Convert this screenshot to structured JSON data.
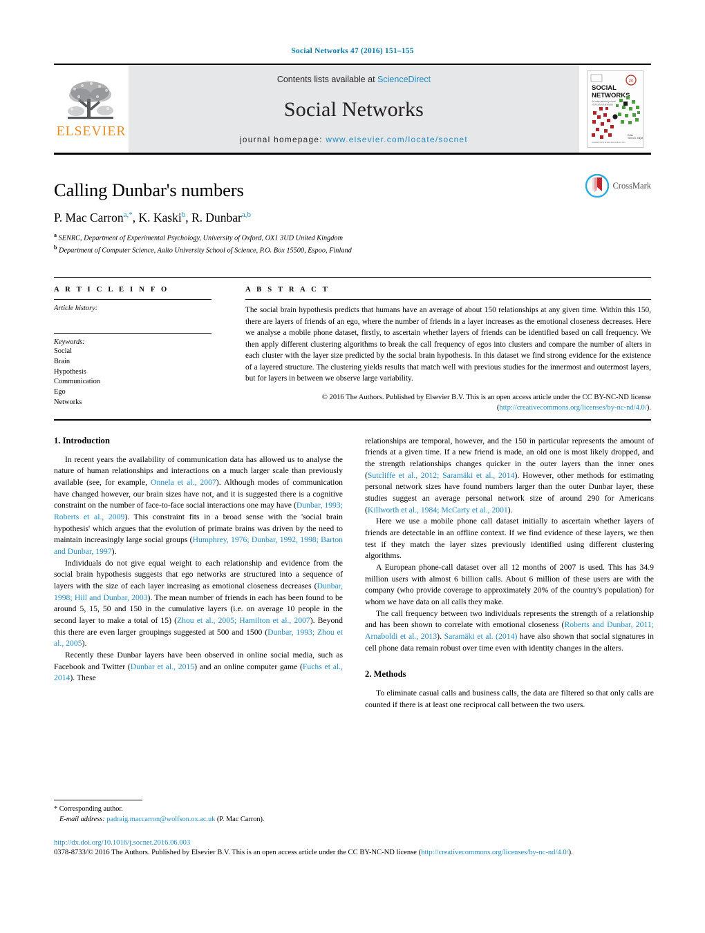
{
  "running_head": "Social Networks 47 (2016) 151–155",
  "masthead": {
    "publisher_name": "ELSEVIER",
    "contents_prefix": "Contents lists available at ",
    "contents_link": "ScienceDirect",
    "journal_title": "Social Networks",
    "homepage_prefix": "journal homepage:",
    "homepage_url": "www.elsevier.com/locate/socnet",
    "cover": {
      "line1": "SOCIAL",
      "line2": "NETWORKS",
      "tagline": "An international journal of structural analysis",
      "badge": "20",
      "editor_label": "Editor",
      "editor_name": "Tom A.B. Snijders"
    }
  },
  "article": {
    "title": "Calling Dunbar's numbers",
    "crossmark_label": "CrossMark",
    "authors_html": "P. Mac Carron<sup>a,*</sup>, K. Kaski<sup>b</sup>, R. Dunbar<sup>a,b</sup>",
    "affiliations": [
      {
        "marker": "a",
        "text": "SENRC, Department of Experimental Psychology, University of Oxford, OX1 3UD United Kingdom"
      },
      {
        "marker": "b",
        "text": "Department of Computer Science, Aalto University School of Science, P.O. Box 15500, Espoo, Finland"
      }
    ]
  },
  "article_info": {
    "heading": "A R T I C L E   I N F O",
    "history_label": "Article history:",
    "keywords_label": "Keywords:",
    "keywords": [
      "Social",
      "Brain",
      "Hypothesis",
      "Communication",
      "Ego",
      "Networks"
    ]
  },
  "abstract": {
    "heading": "A B S T R A C T",
    "text": "The social brain hypothesis predicts that humans have an average of about 150 relationships at any given time. Within this 150, there are layers of friends of an ego, where the number of friends in a layer increases as the emotional closeness decreases. Here we analyse a mobile phone dataset, firstly, to ascertain whether layers of friends can be identified based on call frequency. We then apply different clustering algorithms to break the call frequency of egos into clusters and compare the number of alters in each cluster with the layer size predicted by the social brain hypothesis. In this dataset we find strong evidence for the existence of a layered structure. The clustering yields results that match well with previous studies for the innermost and outermost layers, but for layers in between we observe large variability.",
    "copyright_pre": "© 2016 The Authors. Published by Elsevier B.V. This is an open access article under the CC BY-NC-ND license (",
    "copyright_link": "http://creativecommons.org/licenses/by-nc-nd/4.0/",
    "copyright_post": ")."
  },
  "sections": {
    "introduction_heading": "1.  Introduction",
    "methods_heading": "2.  Methods"
  },
  "left_column": {
    "p1_a": "In recent years the availability of communication data has allowed us to analyse the nature of human relationships and interactions on a much larger scale than previously available (see, for example, ",
    "p1_cite1": "Onnela et al., 2007",
    "p1_b": "). Although modes of communication have changed however, our brain sizes have not, and it is suggested there is a cognitive constraint on the number of face-to-face social interactions one may have (",
    "p1_cite2": "Dunbar, 1993; Roberts et al., 2009",
    "p1_c": "). This constraint fits in a broad sense with the 'social brain hypothesis' which argues that the evolution of primate brains was driven by the need to maintain increasingly large social groups (",
    "p1_cite3": "Humphrey, 1976; Dunbar, 1992, 1998; Barton and Dunbar, 1997",
    "p1_d": ").",
    "p2_a": "Individuals do not give equal weight to each relationship and evidence from the social brain hypothesis suggests that ego networks are structured into a sequence of layers with the size of each layer increasing as emotional closeness decreases (",
    "p2_cite1": "Dunbar, 1998; Hill and Dunbar, 2003",
    "p2_b": "). The mean number of friends in each has been found to be around 5, 15, 50 and 150 in the cumulative layers (i.e. on average 10 people in the second layer to make a total of 15) (",
    "p2_cite2": "Zhou et al., 2005; Hamilton et al., 2007",
    "p2_c": "). Beyond this there are even larger groupings suggested at 500 and 1500 (",
    "p2_cite3": "Dunbar, 1993; Zhou et al., 2005",
    "p2_d": ").",
    "p3_a": "Recently these Dunbar layers have been observed in online social media, such as Facebook and Twitter (",
    "p3_cite1": "Dunbar et al., 2015",
    "p3_b": ") and an online computer game (",
    "p3_cite2": "Fuchs et al., 2014",
    "p3_c": "). These"
  },
  "right_column": {
    "p1_a": "relationships are temporal, however, and the 150 in particular represents the amount of friends at a given time. If a new friend is made, an old one is most likely dropped, and the strength relationships changes quicker in the outer layers than the inner ones (",
    "p1_cite1": "Sutcliffe et al., 2012; Saramäki et al., 2014",
    "p1_b": "). However, other methods for estimating personal network sizes have found numbers larger than the outer Dunbar layer, these studies suggest an average personal network size of around 290 for Americans (",
    "p1_cite2": "Killworth et al., 1984; McCarty et al., 2001",
    "p1_c": ").",
    "p2": "Here we use a mobile phone call dataset initially to ascertain whether layers of friends are detectable in an offline context. If we find evidence of these layers, we then test if they match the layer sizes previously identified using different clustering algorithms.",
    "p3": "A European phone-call dataset over all 12 months of 2007 is used. This has 34.9 million users with almost 6 billion calls. About 6 million of these users are with the company (who provide coverage to approximately 20% of the country's population) for whom we have data on all calls they make.",
    "p4_a": "The call frequency between two individuals represents the strength of a relationship and has been shown to correlate with emotional closeness (",
    "p4_cite1": "Roberts and Dunbar, 2011; Arnaboldi et al., 2013",
    "p4_b": "). ",
    "p4_cite2": "Saramäki et al. (2014)",
    "p4_c": " have also shown that social signatures in cell phone data remain robust over time even with identity changes in the alters.",
    "methods_p1": "To eliminate casual calls and business calls, the data are filtered so that only calls are counted if there is at least one reciprocal call between the two users."
  },
  "footnote": {
    "star": "*",
    "corresponding": "Corresponding author.",
    "email_label": "E-mail address:",
    "email": "padraig.maccarron@wolfson.ox.ac.uk",
    "email_suffix": "(P. Mac Carron)."
  },
  "footer": {
    "doi": "http://dx.doi.org/10.1016/j.socnet.2016.06.003",
    "issn_pre": "0378-8733/© 2016 The Authors. Published by Elsevier B.V. This is an open access article under the CC BY-NC-ND license (",
    "issn_link": "http://creativecommons.org/licenses/by-nc-nd/4.0/",
    "issn_post": ")."
  },
  "colors": {
    "link": "#1f8ac0",
    "elsevier_orange": "#ec8b22",
    "masthead_grey": "#e6e7e8"
  }
}
